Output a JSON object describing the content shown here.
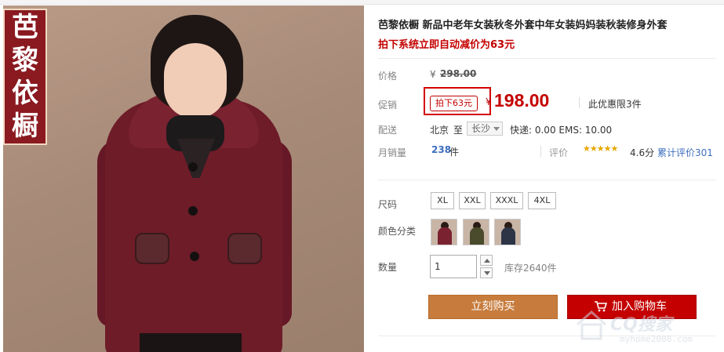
{
  "product": {
    "title": "芭黎依橱 新品中老年女装秋冬外套中年女装妈妈装秋装修身外套",
    "promo_note": "拍下系统立即自动减价为63元",
    "logo_chars": [
      "芭",
      "黎",
      "依",
      "橱"
    ]
  },
  "price": {
    "label": "价格",
    "currency": "¥",
    "original": "298.00"
  },
  "promotion": {
    "label": "促销",
    "tag": "拍下63元",
    "currency": "¥",
    "price": "198.00",
    "limit": "此优惠限3件"
  },
  "shipping": {
    "label": "配送",
    "from": "北京",
    "to_word": "至",
    "destination": "长沙",
    "info": "快递: 0.00 EMS: 10.00"
  },
  "sales": {
    "label": "月销量",
    "count": "238",
    "unit": "件",
    "rating_label": "评价",
    "stars": "★★★★★",
    "score": "4.6分",
    "review_link": "累计评价301"
  },
  "sizes": {
    "label": "尺码",
    "options": [
      "XL",
      "XXL",
      "XXXL",
      "4XL"
    ]
  },
  "colors": {
    "label": "颜色分类",
    "swatch_colors": [
      "#7a2230",
      "#4a4a2c",
      "#2c3446"
    ]
  },
  "quantity": {
    "label": "数量",
    "value": "1",
    "stock": "库存2640件"
  },
  "actions": {
    "buy_now": "立刻购买",
    "add_to_cart": "加入购物车"
  },
  "watermark": {
    "text": "CQ搜家",
    "url": "myhome2008.com"
  },
  "colors_theme": {
    "accent_red": "#c40000",
    "buy_orange": "#c77c3d",
    "link_blue": "#3c6ebd"
  }
}
